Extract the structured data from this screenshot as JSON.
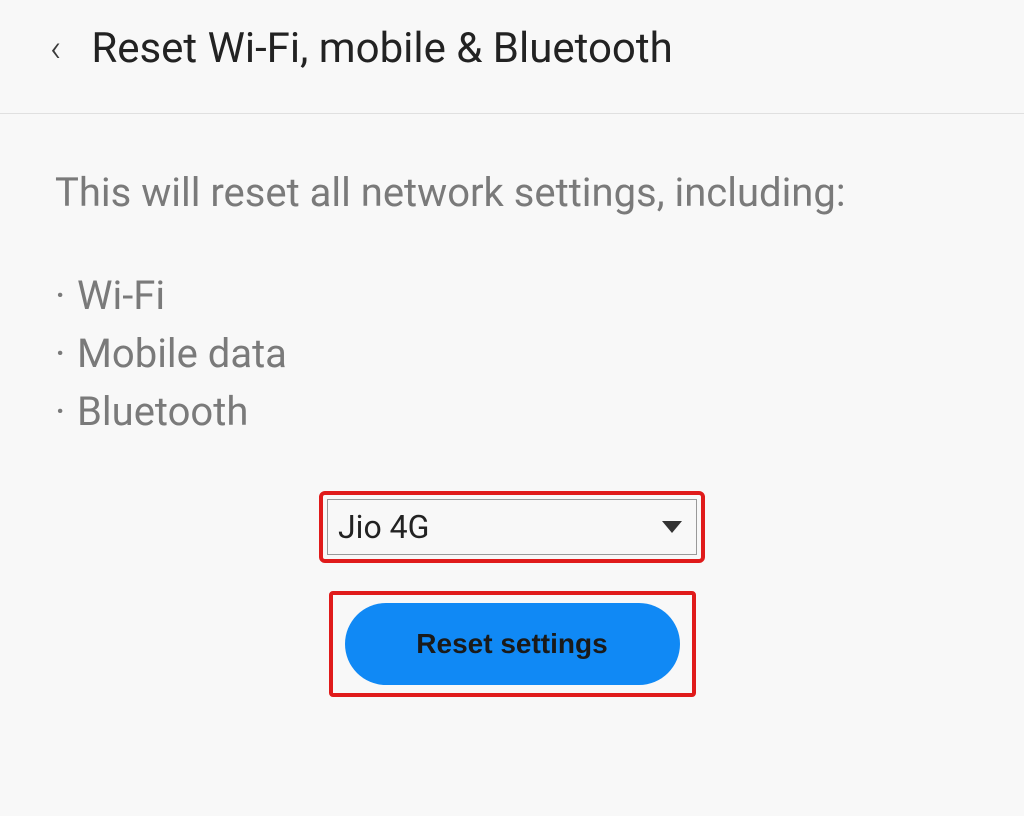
{
  "header": {
    "title": "Reset Wi-Fi, mobile & Bluetooth"
  },
  "content": {
    "description": "This will reset all network settings, including:",
    "bullets": {
      "item0": "Wi-Fi",
      "item1": "Mobile data",
      "item2": "Bluetooth"
    }
  },
  "dropdown": {
    "selected": "Jio 4G"
  },
  "button": {
    "reset_label": "Reset settings"
  },
  "colors": {
    "accent": "#1089f5",
    "highlight": "#e01b1b"
  }
}
